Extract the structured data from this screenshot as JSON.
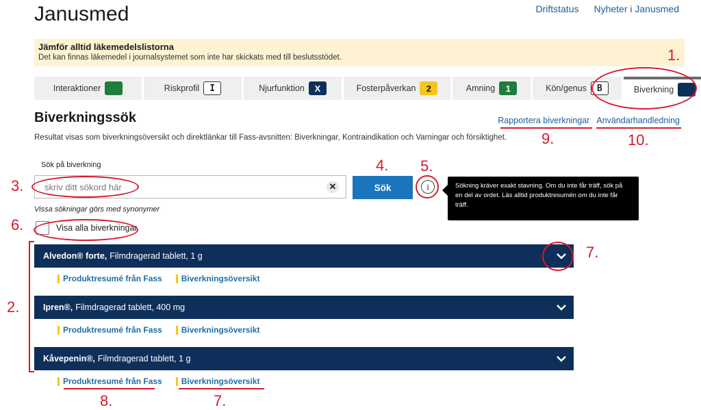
{
  "app": {
    "title": "Janusmed"
  },
  "top_links": [
    "Driftstatus",
    "Nyheter i Janusmed"
  ],
  "banner": {
    "title": "Jämför alltid läkemedelslistorna",
    "text": "Det kan finnas läkemedel i journalsystemet som inte har skickats med till beslutsstödet."
  },
  "tabs": [
    {
      "label": "Interaktioner",
      "badge": "",
      "badge_style": "green"
    },
    {
      "label": "Riskprofil",
      "badge": "I",
      "badge_style": "outline"
    },
    {
      "label": "Njurfunktion",
      "badge": "X",
      "badge_style": "navy"
    },
    {
      "label": "Fosterpåverkan",
      "badge": "2",
      "badge_style": "yellow"
    },
    {
      "label": "Amning",
      "badge": "1",
      "badge_style": "green"
    },
    {
      "label": "Kön/genus",
      "badge": "B",
      "badge_style": "outline"
    },
    {
      "label": "Biverkning",
      "badge": "",
      "badge_style": "navy",
      "active": true
    }
  ],
  "section": {
    "title": "Biverkningssök",
    "link_report": "Rapportera biverkningar",
    "link_manual": "Användarhandledning",
    "intro": "Resultat visas som biverkningsöversikt och direktlänkar till Fass-avsnitten: Biverkningar, Kontraindikation och Varningar och försiktighet."
  },
  "search": {
    "label": "Sök på biverkning",
    "placeholder": "skriv ditt sökord här",
    "value": "",
    "button": "Sök",
    "info_symbol": "i",
    "tooltip": "Sökning kräver exakt stavning. Om du inte får träff, sök på en del av ordet. Läs alltid produktresumén om du inte får träff.",
    "synonym_note": "Vissa sökningar görs med synonymer",
    "show_all_label": "Visa alla biverkningar",
    "show_all_checked": false
  },
  "results": [
    {
      "name": "Alvedon® forte,",
      "detail": "Filmdragerad tablett, 1 g",
      "link1": "Produktresumé från Fass",
      "link2": "Biverkningsöversikt"
    },
    {
      "name": "Ipren®,",
      "detail": "Filmdragerad tablett, 400 mg",
      "link1": "Produktresumé från Fass",
      "link2": "Biverkningsöversikt"
    },
    {
      "name": "Kåvepenin®,",
      "detail": "Filmdragerad tablett, 1 g",
      "link1": "Produktresumé från Fass",
      "link2": "Biverkningsöversikt"
    }
  ],
  "annotations": {
    "n1": "1.",
    "n2": "2.",
    "n3": "3.",
    "n4": "4.",
    "n5": "5.",
    "n6": "6.",
    "n7a": "7.",
    "n7b": "7.",
    "n8": "8.",
    "n9": "9.",
    "n10": "10."
  },
  "colors": {
    "navy": "#0e2f5a",
    "primary_blue": "#1b75bc",
    "link": "#1c5d99",
    "banner_bg": "#fdf2d2",
    "annotation_red": "#d9182b",
    "yellow": "#f5c61b",
    "green": "#1e7e3d"
  }
}
